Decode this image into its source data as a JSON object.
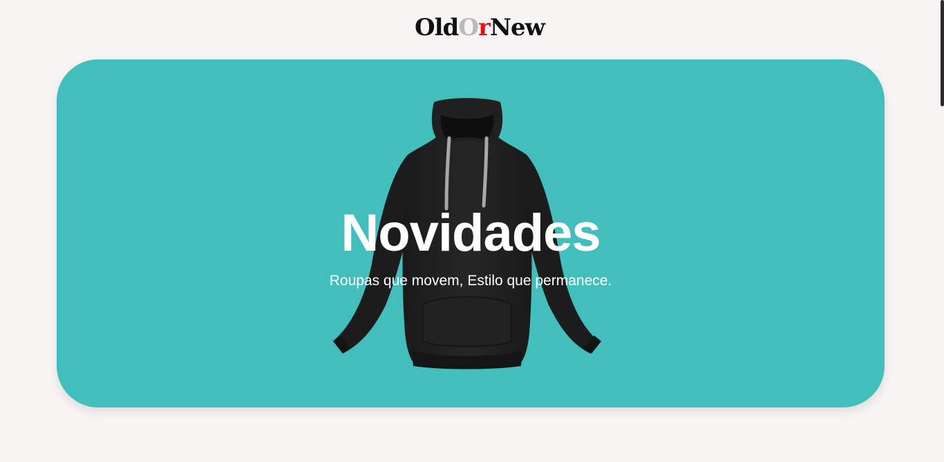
{
  "header": {
    "logo": {
      "part_old": "Old",
      "part_o": "O",
      "part_r": "r",
      "part_new": "New"
    }
  },
  "hero": {
    "title": "Novidades",
    "subtitle": "Roupas que movem, Estilo que permanece.",
    "image_icon": "black-hoodie-image"
  },
  "colors": {
    "page_background": "#f7f5f3",
    "hero_background": "#42bfbd",
    "logo_dark": "#111111",
    "logo_grey": "#b9b9b9",
    "logo_red": "#e3101b",
    "hero_text": "#ffffff"
  }
}
